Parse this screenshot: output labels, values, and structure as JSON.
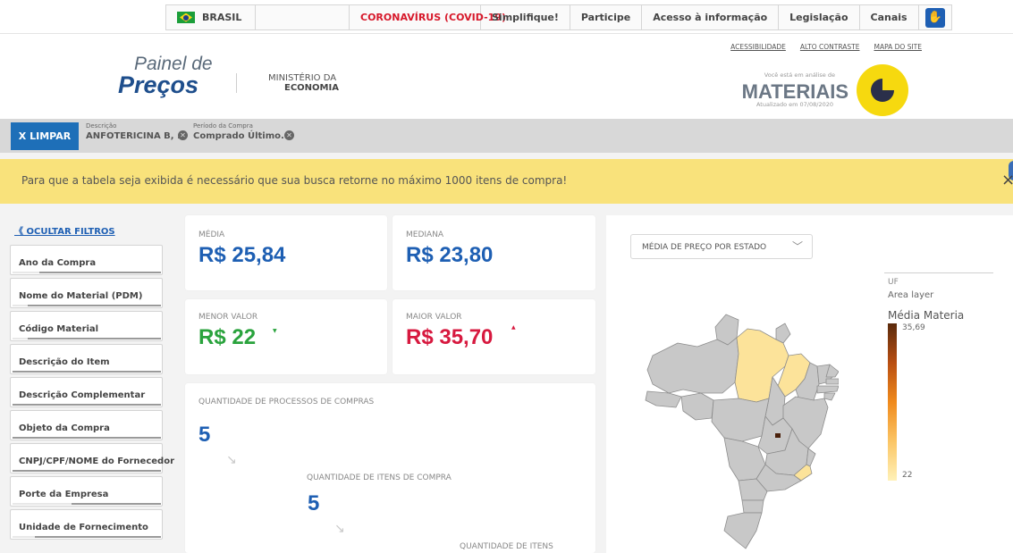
{
  "topbar": {
    "country": "BRASIL",
    "items": [
      "CORONAVÍRUS (COVID-19)",
      "Simplifique!",
      "Participe",
      "Acesso à informação",
      "Legislação",
      "Canais"
    ]
  },
  "header": {
    "logo_line1": "Painel de",
    "logo_line2": "Preços",
    "ministry_line1": "MINISTÉRIO DA",
    "ministry_line2": "ECONOMIA",
    "links": [
      "ACESSIBILIDADE",
      "ALTO CONTRASTE",
      "MAPA DO SITE"
    ],
    "analysis_label": "Você está em análise de",
    "analysis_title": "MATERIAIS",
    "updated": "Atualizado em 07/08/2020"
  },
  "filterbar": {
    "clear_label": "X  LIMPAR",
    "chips": [
      {
        "label": "Descrição",
        "value": "ANFOTERICINA B, ..."
      },
      {
        "label": "Período da Compra",
        "value": "Comprado Último..."
      }
    ]
  },
  "alert": {
    "text": "Para que a tabela seja exibida é necessário que sua busca retorne no máximo 1000 itens de compra!",
    "close": "×"
  },
  "sidebar": {
    "hide_label": "OCULTAR FILTROS",
    "filters": [
      {
        "label": "Ano da Compra",
        "scroll": 0.18
      },
      {
        "label": "Nome do Material (PDM)",
        "scroll": 0.1
      },
      {
        "label": "Código Material",
        "scroll": 0.1
      },
      {
        "label": "Descrição do Item",
        "scroll": 0.0
      },
      {
        "label": "Descrição Complementar",
        "scroll": 0.0
      },
      {
        "label": "Objeto da Compra",
        "scroll": 0.0
      },
      {
        "label": "CNPJ/CPF/NOME do Fornecedor",
        "scroll": 0.0
      },
      {
        "label": "Porte da Empresa",
        "scroll": 0.4
      },
      {
        "label": "Unidade de Fornecimento",
        "scroll": 0.15
      }
    ]
  },
  "stats": {
    "media_label": "MÉDIA",
    "media_value": "R$ 25,84",
    "mediana_label": "MEDIANA",
    "mediana_value": "R$ 23,80",
    "menor_label": "MENOR VALOR",
    "menor_value": "R$ 22",
    "maior_label": "MAIOR VALOR",
    "maior_value": "R$ 35,70",
    "colors": {
      "blue": "#1e5fb3",
      "green": "#2aa33d",
      "red": "#d7193f"
    }
  },
  "quantities": {
    "processos_label": "QUANTIDADE DE PROCESSOS DE COMPRAS",
    "processos_value": "5",
    "itens_label": "QUANTIDADE DE ITENS DE COMPRA",
    "itens_value": "5",
    "third_label": "QUANTIDADE DE ITENS"
  },
  "map": {
    "select_value": "MÉDIA DE PREÇO POR ESTADO",
    "legend_uf": "UF",
    "legend_layer": "Area layer",
    "legend_title": "Média Materia",
    "legend_max": "35,69",
    "legend_min": "22",
    "colors": {
      "base": "#c8c8c8",
      "highlight": "#fce39a",
      "dark": "#4a200a"
    }
  }
}
